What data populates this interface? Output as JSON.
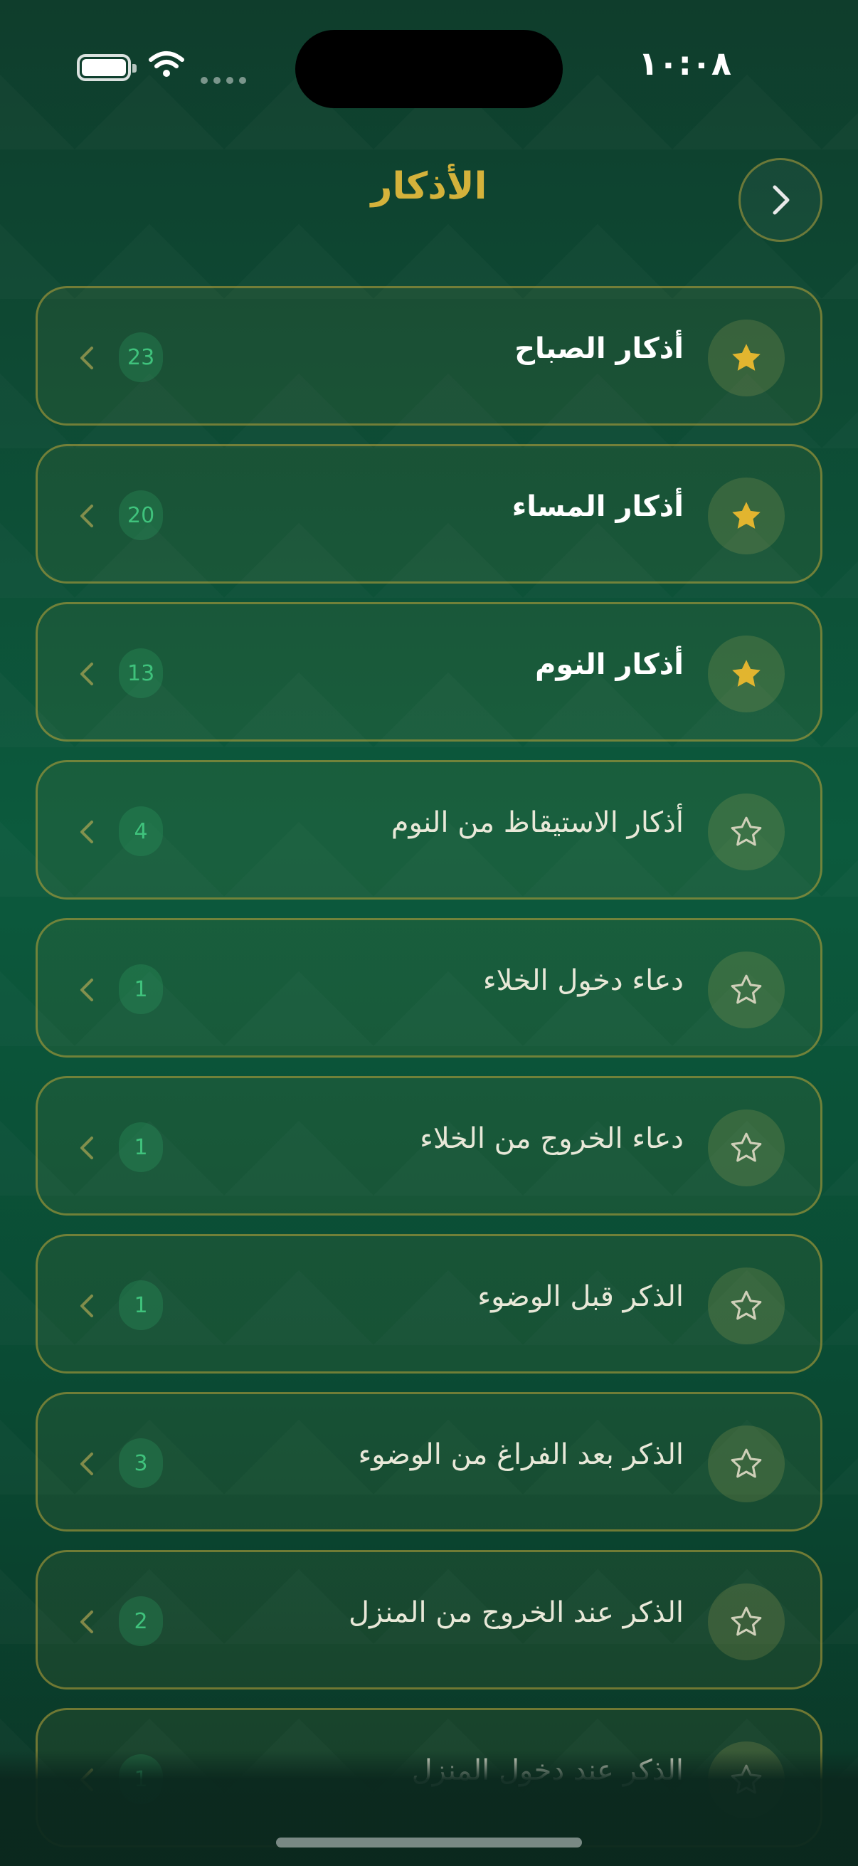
{
  "status": {
    "time": "١٠:٠٨"
  },
  "header": {
    "title": "الأذكار",
    "back_icon": "chevron-right-icon"
  },
  "items": [
    {
      "label": "أذكار الصباح",
      "count": "23",
      "favorite": true
    },
    {
      "label": "أذكار المساء",
      "count": "20",
      "favorite": true
    },
    {
      "label": "أذكار النوم",
      "count": "13",
      "favorite": true
    },
    {
      "label": "أذكار الاستيقاظ من النوم",
      "count": "4",
      "favorite": false
    },
    {
      "label": "دعاء دخول الخلاء",
      "count": "1",
      "favorite": false
    },
    {
      "label": "دعاء الخروج من الخلاء",
      "count": "1",
      "favorite": false
    },
    {
      "label": "الذكر قبل الوضوء",
      "count": "1",
      "favorite": false
    },
    {
      "label": "الذكر بعد الفراغ من الوضوء",
      "count": "3",
      "favorite": false
    },
    {
      "label": "الذكر عند الخروج من المنزل",
      "count": "2",
      "favorite": false
    },
    {
      "label": "الذكر عند دخول المنزل",
      "count": "1",
      "favorite": false
    }
  ],
  "colors": {
    "accent": "#d4b23b",
    "badge_text": "#3fc27c",
    "background": "#0c5a3d"
  }
}
